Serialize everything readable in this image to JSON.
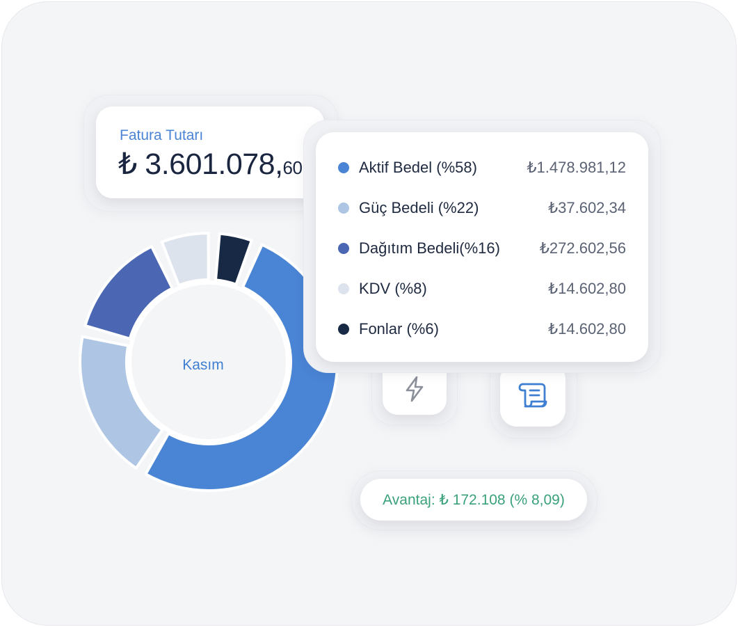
{
  "invoice": {
    "label": "Fatura Tutarı",
    "amount_main": "₺ 3.601.078,",
    "amount_cents": "60"
  },
  "breakdown": [
    {
      "label": "Aktif Bedel (%58)",
      "value": "₺1.478.981,12",
      "color": "#4a84d4"
    },
    {
      "label": "Güç Bedeli (%22)",
      "value": "₺37.602,34",
      "color": "#aec6e4"
    },
    {
      "label": "Dağıtım Bedeli(%16)",
      "value": "₺272.602,56",
      "color": "#4b66b2"
    },
    {
      "label": "KDV (%8)",
      "value": "₺14.602,80",
      "color": "#dde3ec"
    },
    {
      "label": "Fonlar (%6)",
      "value": "₺14.602,80",
      "color": "#172945"
    }
  ],
  "chart_data": {
    "type": "pie",
    "center_label": "Kasım",
    "categories": [
      "Aktif Bedel",
      "Güç Bedeli",
      "Dağıtım Bedeli",
      "KDV",
      "Fonlar"
    ],
    "values": [
      58,
      22,
      16,
      8,
      6
    ],
    "colors": [
      "#4a84d4",
      "#aec6e4",
      "#4b66b2",
      "#dde3ec",
      "#172945"
    ]
  },
  "icons": {
    "energy": "lightning-icon",
    "invoice": "invoice-scroll-icon"
  },
  "advantage": {
    "text": "Avantaj: ₺ 172.108 (% 8,09)",
    "color": "#3aa17a"
  }
}
